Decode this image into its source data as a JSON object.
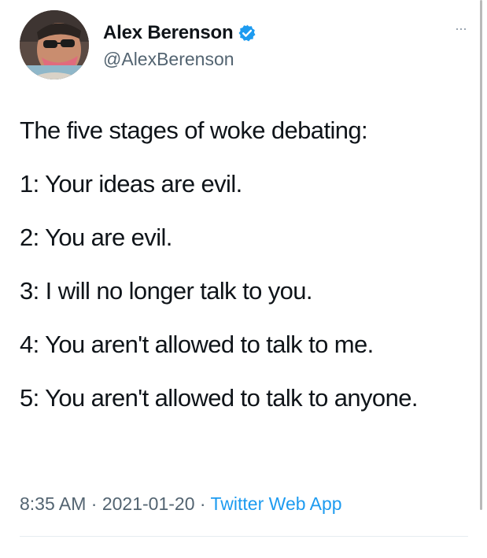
{
  "tweet": {
    "author": {
      "display_name": "Alex Berenson",
      "handle": "@AlexBerenson",
      "verified": true,
      "avatar_icon": "profile-photo"
    },
    "more_label": "···",
    "lines": [
      "The five stages of woke debating:",
      "1: Your ideas are evil.",
      "2: You are evil.",
      "3: I will no longer talk to you.",
      "4: You aren't allowed to talk to me.",
      "5: You aren't allowed to talk to anyone."
    ],
    "meta": {
      "time": "8:35 AM",
      "separator": " · ",
      "date": "2021-01-20",
      "source": "Twitter Web App"
    }
  },
  "colors": {
    "text": "#0f1419",
    "secondary": "#536471",
    "link": "#1d9bf0",
    "verified_badge": "#1d9bf0"
  }
}
